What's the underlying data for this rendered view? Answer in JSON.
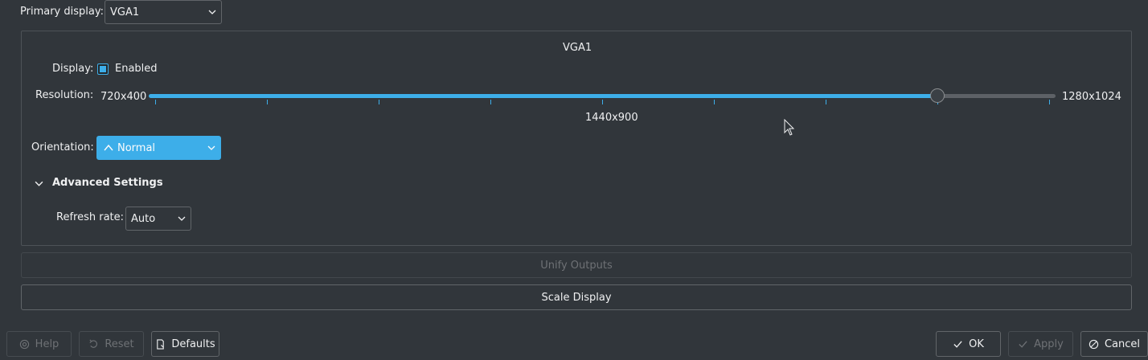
{
  "primary_display": {
    "label": "Primary display:",
    "value": "VGA1"
  },
  "output": {
    "title": "VGA1",
    "display_label": "Display:",
    "enabled_label": "Enabled",
    "enabled": true,
    "resolution_label": "Resolution:",
    "resolution_min": "720x400",
    "resolution_max": "1280x1024",
    "resolution_current": "1440x900",
    "slider_tick_count": 9,
    "slider_position_index": 7,
    "orientation_label": "Orientation:",
    "orientation_value": "Normal",
    "advanced_label": "Advanced Settings",
    "refresh_label": "Refresh rate:",
    "refresh_value": "Auto"
  },
  "unify_outputs": "Unify Outputs",
  "scale_display": "Scale Display",
  "buttons": {
    "help": "Help",
    "reset": "Reset",
    "defaults": "Defaults",
    "ok": "OK",
    "apply": "Apply",
    "cancel": "Cancel"
  },
  "colors": {
    "background": "#31363b",
    "accent": "#3daee9",
    "text": "#eff0f1",
    "disabled_text": "#6e7175"
  },
  "icons": {
    "chevron": "chevron-down-icon",
    "orientation": "arrow-up-icon",
    "expand": "chevron-down-icon",
    "help": "help-icon",
    "reset": "undo-icon",
    "defaults": "document-revert-icon",
    "ok": "check-icon",
    "apply": "check-icon",
    "cancel": "cancel-icon"
  }
}
